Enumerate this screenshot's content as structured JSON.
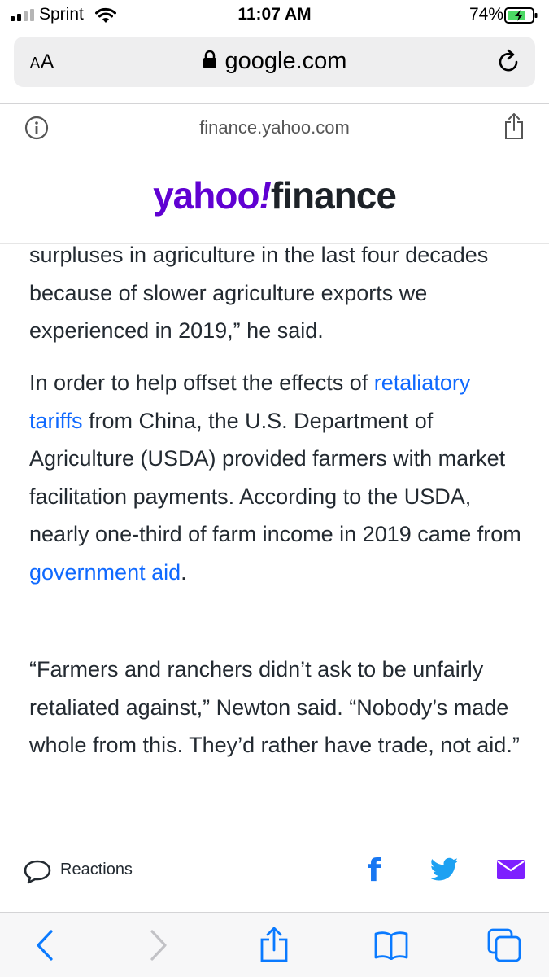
{
  "status": {
    "carrier": "Sprint",
    "time": "11:07 AM",
    "battery": "74%"
  },
  "browser": {
    "aa_label": "AA",
    "domain": "google.com",
    "page_url": "finance.yahoo.com"
  },
  "site": {
    "logo_yahoo": "yahoo",
    "logo_bang": "!",
    "logo_finance": "finance"
  },
  "article": {
    "p1": "surpluses in agriculture in the last four decades because of slower agriculture exports we experienced in 2019,” he said.",
    "p2_before": "In order to help offset the effects of ",
    "p2_link1": "retaliatory tariffs",
    "p2_middle": " from China, the U.S. Department of Agriculture (USDA) provided farmers with market facilitation payments. According to the USDA, nearly one-third of farm income in 2019 came from ",
    "p2_link2": "government aid",
    "p2_after": ".",
    "p3": "“Farmers and ranchers didn’t ask to be unfairly retaliated against,” Newton said. “Nobody’s made whole from this. They’d rather have trade, not aid.”"
  },
  "reactions": {
    "label": "Reactions",
    "facebook_glyph": "f"
  },
  "colors": {
    "yahoo_purple": "#6001d2",
    "link_blue": "#0f69ff",
    "ios_blue": "#0a7aff",
    "facebook_blue": "#1877f2",
    "twitter_blue": "#1da1f2",
    "mail_purple": "#7e1fff",
    "battery_green": "#4cd964"
  },
  "icons": [
    "signal-icon",
    "wifi-icon",
    "battery-icon",
    "lock-icon",
    "reload-icon",
    "info-icon",
    "share-icon",
    "comment-icon",
    "facebook-icon",
    "twitter-icon",
    "mail-icon",
    "back-icon",
    "forward-icon",
    "bookmarks-icon",
    "tabs-icon"
  ]
}
